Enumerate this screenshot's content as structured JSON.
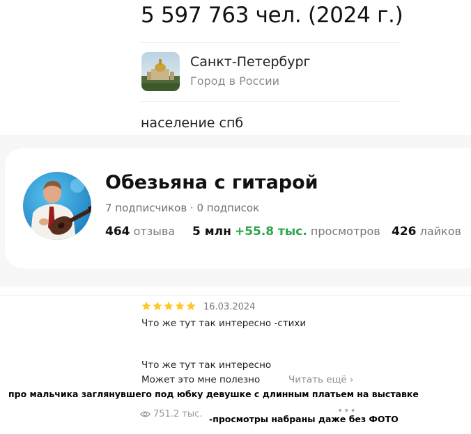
{
  "snippet": {
    "population": "5 597 763 чел. (2024 г.)",
    "city_name": "Санкт-Петербург",
    "city_subtitle": "Город в России",
    "query": "население спб"
  },
  "profile": {
    "name": "Обезьяна с гитарой",
    "subscriptions": "7 подписчиков · 0 подписок",
    "reviews_count": "464",
    "reviews_label": "отзыва",
    "views_count": "5 млн",
    "views_delta": "+55.8 тыс.",
    "views_label": "просмотров",
    "likes_count": "426",
    "likes_label": "лайков"
  },
  "review": {
    "rating": 5,
    "date": "16.03.2024",
    "line1": "Что же тут так интересно  -стихи",
    "line2": "Что же тут так интересно",
    "line3": "Может это мне полезно",
    "read_more": "Читать ещё",
    "read_more_arrow": "›",
    "views": "751.2 тыс.",
    "more_dots": "•••"
  },
  "annotations": {
    "caption1": "про мальчика заглянувшего под юбку девушке с длинным платьем на выставке",
    "caption2": "-просмотры набраны даже без ФОТО"
  },
  "colors": {
    "accent_green": "#2ba44a",
    "star_yellow": "#ffc627",
    "muted_text": "#8b8b8b"
  }
}
